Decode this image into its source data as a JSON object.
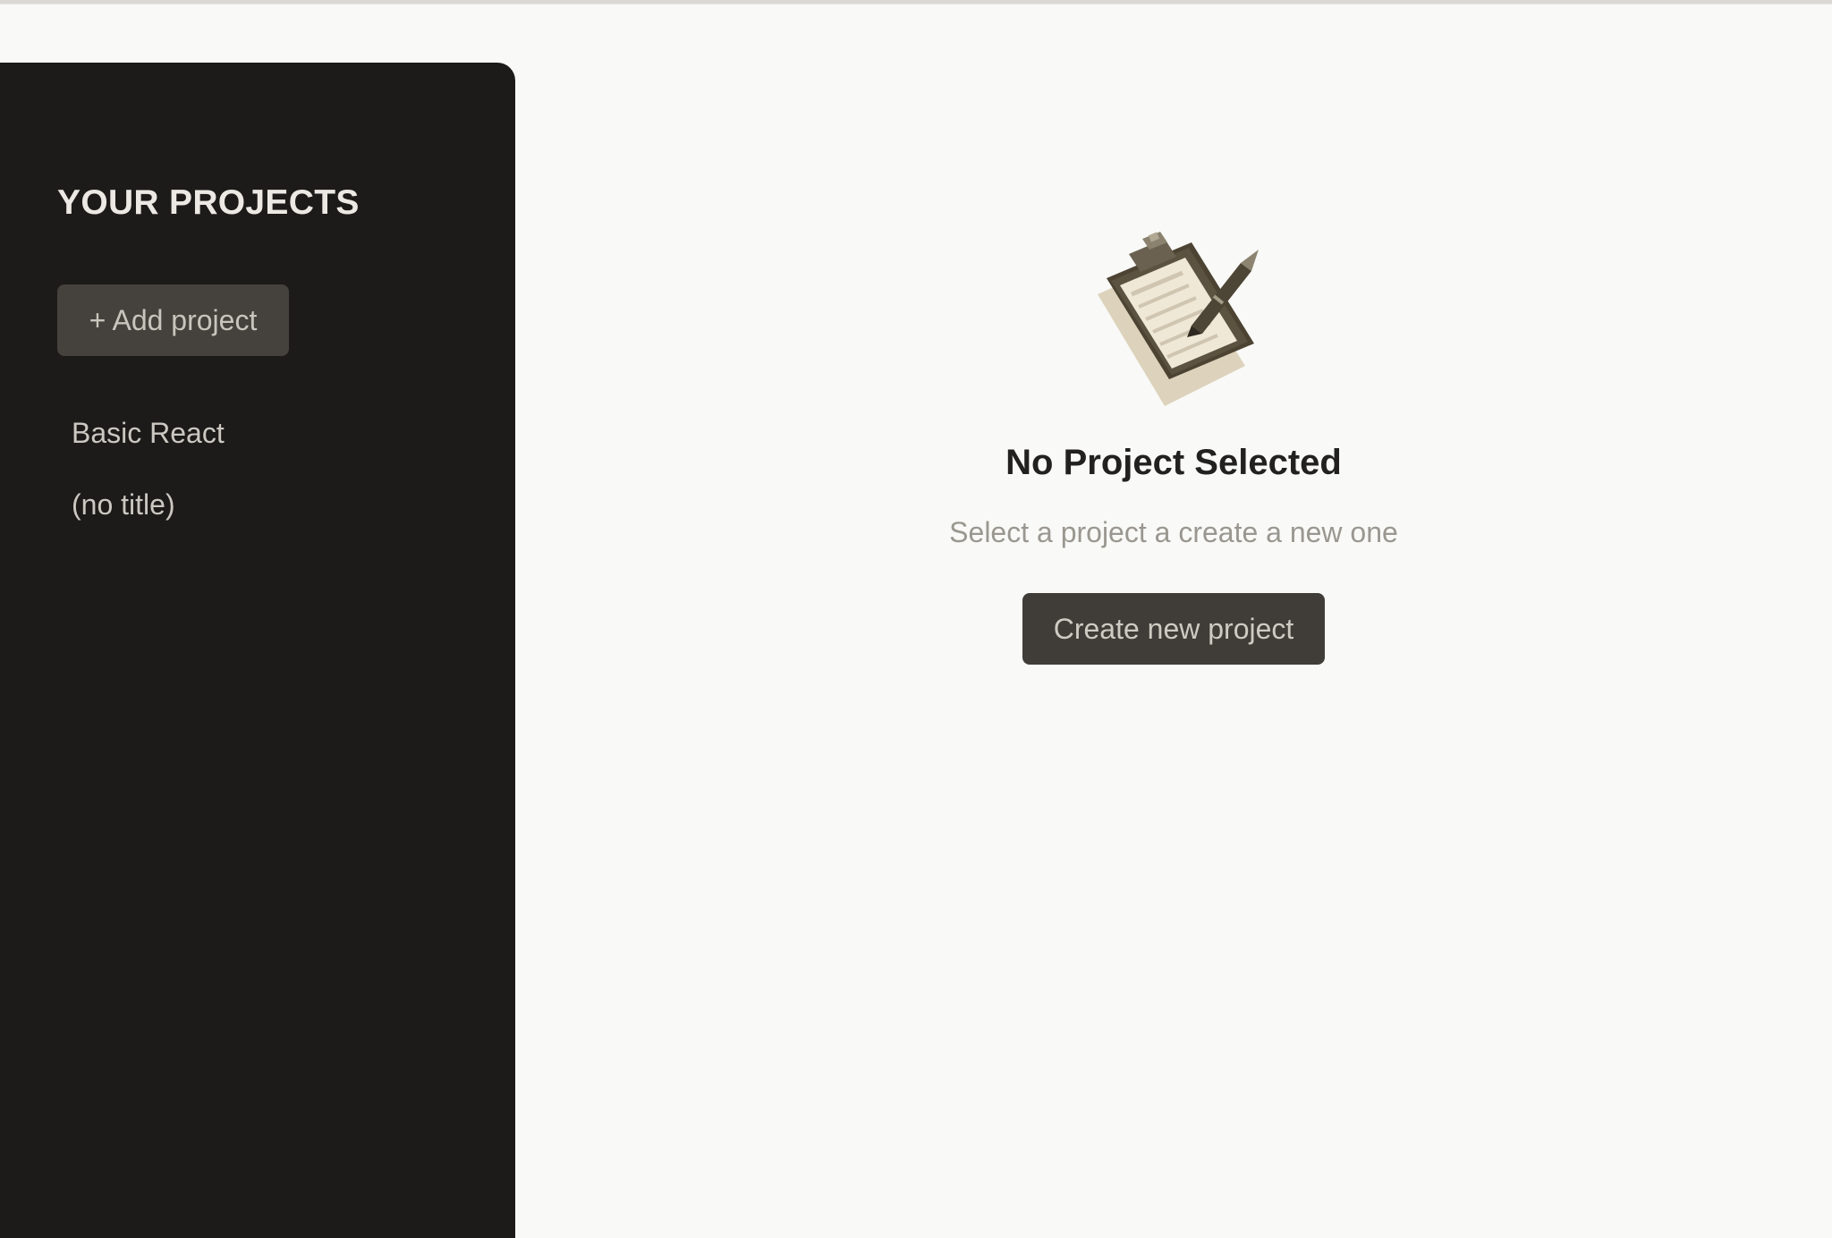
{
  "sidebar": {
    "title": "YOUR PROJECTS",
    "add_button_label": "+ Add project",
    "projects": [
      {
        "label": "Basic React"
      },
      {
        "label": "(no title)"
      }
    ]
  },
  "main": {
    "illustration_icon": "clipboard-with-pen-icon",
    "title": "No Project Selected",
    "subtitle": "Select a project a create a new one",
    "create_button_label": "Create new project"
  },
  "colors": {
    "page_background": "#f9f9f7",
    "sidebar_background": "#1c1b19",
    "button_background": "#45423d",
    "title_text": "#22211f",
    "muted_text": "#9a9790"
  }
}
